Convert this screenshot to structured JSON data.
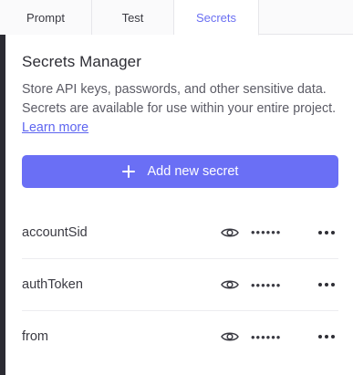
{
  "tabs": [
    {
      "label": "Prompt"
    },
    {
      "label": "Test"
    },
    {
      "label": "Secrets",
      "active": true
    }
  ],
  "panel": {
    "title": "Secrets Manager",
    "description": "Store API keys, passwords, and other sensitive data. Secrets are available for use within your entire project.",
    "learn_more": "Learn more"
  },
  "add_button": {
    "label": "Add new secret",
    "icon": "plus-icon"
  },
  "secrets": [
    {
      "name": "accountSid",
      "masked": "••••••"
    },
    {
      "name": "authToken",
      "masked": "••••••"
    },
    {
      "name": "from",
      "masked": "••••••"
    }
  ],
  "colors": {
    "accent": "#6a6ff5",
    "link": "#5d65f0",
    "rail": "#2b2b33"
  }
}
